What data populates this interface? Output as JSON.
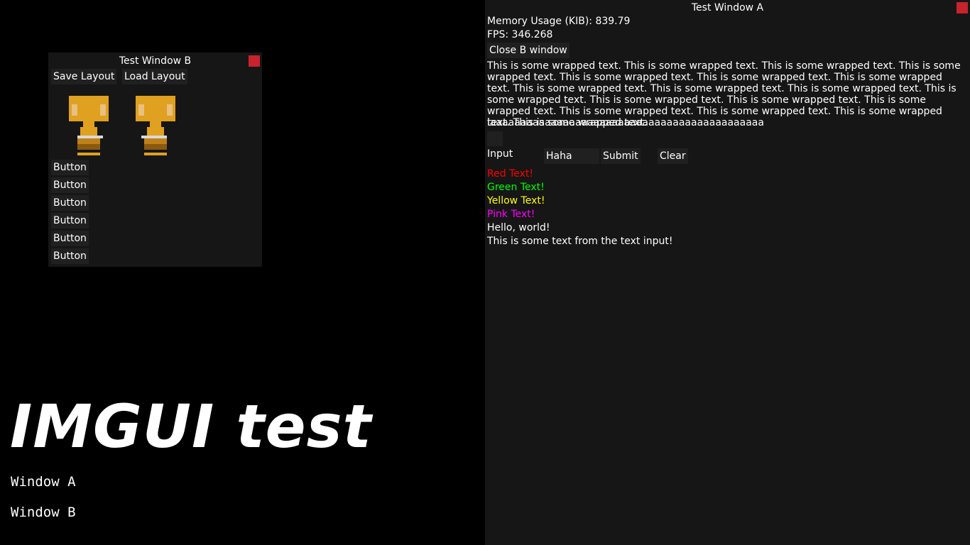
{
  "window_b": {
    "title": "Test Window B",
    "save_layout": "Save Layout",
    "load_layout": "Load Layout",
    "buttons": [
      "Button",
      "Button",
      "Button",
      "Button",
      "Button",
      "Button"
    ]
  },
  "window_a": {
    "title": "Test Window A",
    "memory_usage": "Memory Usage (KIB): 839.79",
    "fps": "FPS: 346.268",
    "close_b_button": "Close B window",
    "wrapped_text": "This is some wrapped text. This is some wrapped text. This is some wrapped text. This is some wrapped text. This is some wrapped text. This is some wrapped text. This is some wrapped text. This is some wrapped text. This is some wrapped text. This is some wrapped text. This is some wrapped text. This is some wrapped text. This is some wrapped text. This is some wrapped text. This is some wrapped text. This is some wrapped text. This is some wrapped text. This is some wrapped text.",
    "long_line": "iaaaaaaaaaaaaaaaaaaaaaaaaaaaaaaaaaaaaaaaaaaaaa",
    "input_label": "Input",
    "input_value": "Haha",
    "submit_button": "Submit",
    "clear_button": "Clear",
    "colored_lines": [
      {
        "text": "Red Text!",
        "color": "#ff0000"
      },
      {
        "text": "Green Text!",
        "color": "#00ff00"
      },
      {
        "text": "Yellow Text!",
        "color": "#ffff00"
      },
      {
        "text": "Pink Text!",
        "color": "#ff00ff"
      }
    ],
    "hello": "Hello, world!",
    "from_input": "This is some text from the text input!"
  },
  "app": {
    "big_title": "IMGUI test",
    "labels": [
      "Window A",
      "Window B"
    ]
  },
  "colors": {
    "window_bg": "#161616",
    "button_bg": "#202020",
    "close_red": "#c8232c",
    "sprite_gold": "#e0a020"
  }
}
